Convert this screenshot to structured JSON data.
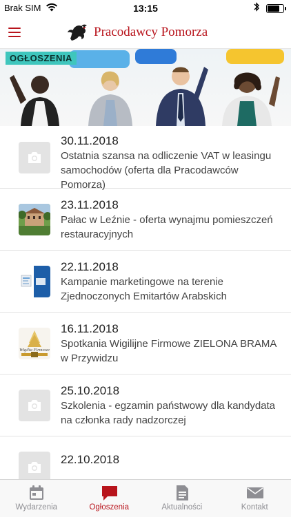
{
  "status_bar": {
    "carrier": "Brak SIM",
    "time": "13:15"
  },
  "header": {
    "brand": "Pracodawcy Pomorza"
  },
  "banner": {
    "badge": "OGŁOSZENIA"
  },
  "items": [
    {
      "date": "30.11.2018",
      "title": "Ostatnia szansa na odliczenie VAT w leasingu samochodów (oferta dla Pracodawców Pomorza)",
      "thumb": "placeholder"
    },
    {
      "date": "23.11.2018",
      "title": "Pałac w Leźnie - oferta wynajmu pomieszczeń restauracyjnych",
      "thumb": "palace"
    },
    {
      "date": "22.11.2018",
      "title": "Kampanie marketingowe na terenie Zjednoczonych Emitartów Arabskich",
      "thumb": "marketing"
    },
    {
      "date": "16.11.2018",
      "title": "Spotkania Wigilijne Firmowe ZIELONA BRAMA w Przywidzu",
      "thumb": "wigilia"
    },
    {
      "date": "25.10.2018",
      "title": "Szkolenia - egzamin państwowy dla kandydata na członka rady nadzorczej",
      "thumb": "placeholder"
    },
    {
      "date": "22.10.2018",
      "title": "",
      "thumb": "placeholder"
    }
  ],
  "tabs": [
    {
      "label": "Wydarzenia",
      "icon": "calendar-icon"
    },
    {
      "label": "Ogłoszenia",
      "icon": "chat-bubble-icon",
      "active": true
    },
    {
      "label": "Aktualności",
      "icon": "document-icon"
    },
    {
      "label": "Kontakt",
      "icon": "envelope-icon"
    }
  ],
  "colors": {
    "accent": "#b8141c",
    "inactive": "#8e8e93",
    "badge": "#3fc6bd"
  }
}
